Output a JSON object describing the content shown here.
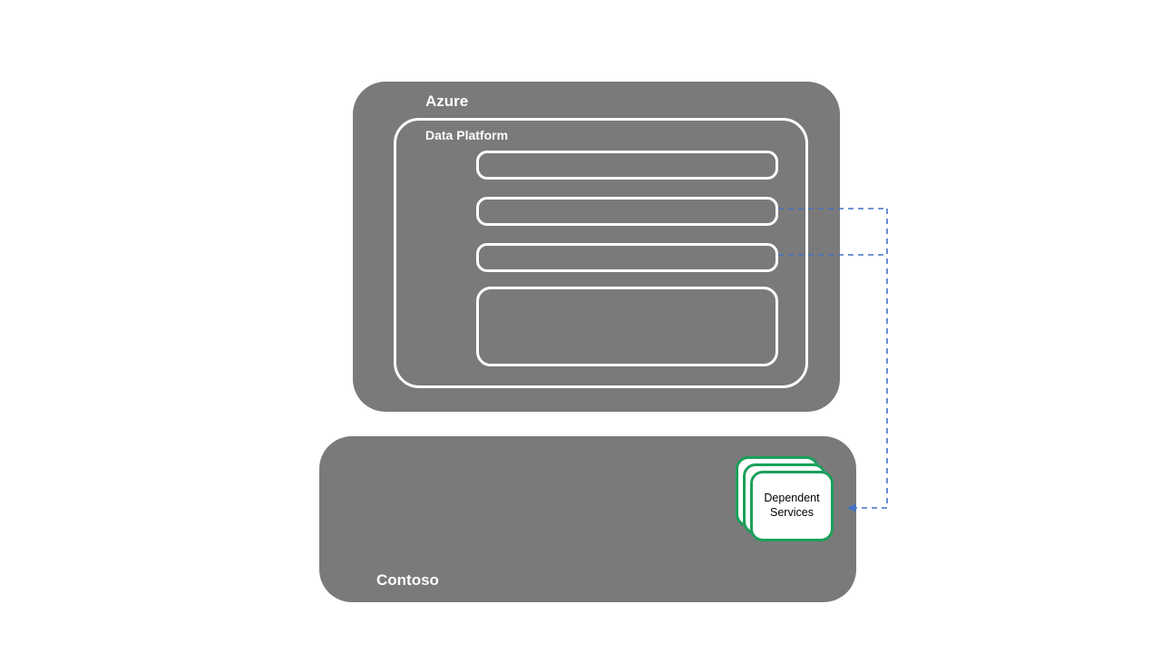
{
  "azure": {
    "title": "Azure",
    "data_platform": {
      "title": "Data Platform"
    },
    "slots": [
      "",
      "",
      "",
      ""
    ]
  },
  "contoso": {
    "title": "Contoso",
    "dependent_services": {
      "label_line1": "Dependent",
      "label_line2": "Services"
    }
  },
  "colors": {
    "container_fill": "#7a7a7a",
    "accent_green": "#1aa05a",
    "connector_blue": "#4472c4"
  }
}
